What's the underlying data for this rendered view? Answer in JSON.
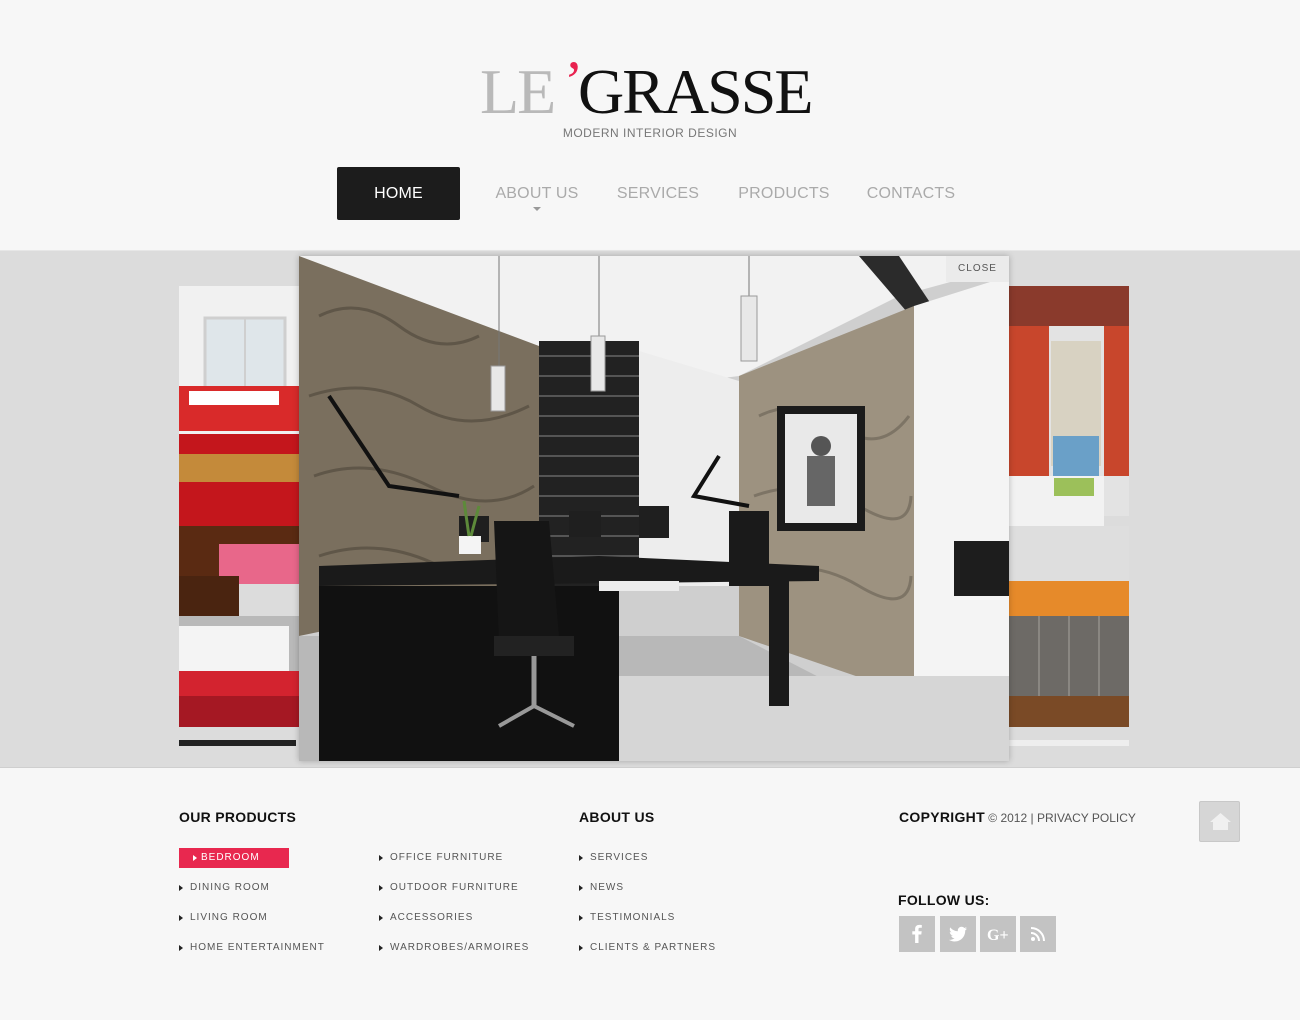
{
  "brand": {
    "logo_le": "LE",
    "logo_apostrophe": "’",
    "logo_grasse": "GRASSE",
    "tagline": "MODERN INTERIOR DESIGN",
    "accent_color": "#e8224f"
  },
  "nav": {
    "items": [
      {
        "label": "HOME",
        "active": true
      },
      {
        "label": "ABOUT US",
        "has_dropdown": true
      },
      {
        "label": "SERVICES"
      },
      {
        "label": "PRODUCTS"
      },
      {
        "label": "CONTACTS"
      }
    ]
  },
  "slider": {
    "close_label": "CLOSE",
    "main_image": "modern-office-interior",
    "left_thumb": "red-bedroom-interior",
    "right_thumb": "orange-living-room-interior"
  },
  "footer": {
    "products": {
      "title": "OUR PRODUCTS",
      "col1": [
        "BEDROOM",
        "DINING ROOM",
        "LIVING ROOM",
        "HOME ENTERTAINMENT"
      ],
      "col2": [
        "OFFICE FURNITURE",
        "OUTDOOR FURNITURE",
        "ACCESSORIES",
        "WARDROBES/ARMOIRES"
      ]
    },
    "about": {
      "title": "ABOUT US",
      "links": [
        "SERVICES",
        "NEWS",
        "TESTIMONIALS",
        "CLIENTS & PARTNERS"
      ]
    },
    "copyright": {
      "label": "COPYRIGHT",
      "year_text": "© 2012 |",
      "privacy": "PRIVACY POLICY"
    },
    "follow": {
      "title": "FOLLOW US:",
      "icons": [
        "facebook-icon",
        "twitter-icon",
        "google-plus-icon",
        "rss-icon"
      ]
    }
  }
}
